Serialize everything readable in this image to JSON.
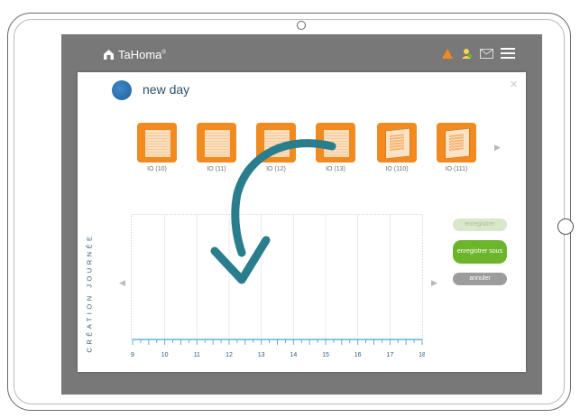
{
  "app": {
    "logo_text": "TaHoma",
    "logo_mark": "®"
  },
  "topbar": {
    "icons": [
      "warning-icon",
      "user-icon",
      "mail-icon",
      "menu-icon"
    ]
  },
  "modal": {
    "title": "new day",
    "close_label": "×",
    "devices": [
      {
        "label": "IO (10)",
        "type": "shutter"
      },
      {
        "label": "IO (11)",
        "type": "shutter"
      },
      {
        "label": "IO (12)",
        "type": "shutter"
      },
      {
        "label": "IO (13)",
        "type": "shutter"
      },
      {
        "label": "IO (110)",
        "type": "window"
      },
      {
        "label": "IO (111)",
        "type": "window"
      }
    ],
    "vertical_title": "CRÉATION JOURNÉE",
    "timeline": {
      "hours": [
        "9",
        "10",
        "11",
        "12",
        "13",
        "14",
        "15",
        "16",
        "17",
        "18"
      ]
    },
    "buttons": {
      "save": "enregistrer",
      "save_as": "enregistrer sous",
      "cancel": "annuler"
    }
  },
  "colors": {
    "accent": "#f18a1f",
    "brand": "#2b5a7a",
    "success": "#6cb52b",
    "arrow": "#2a7d8c",
    "tick": "#4aa9d8"
  }
}
